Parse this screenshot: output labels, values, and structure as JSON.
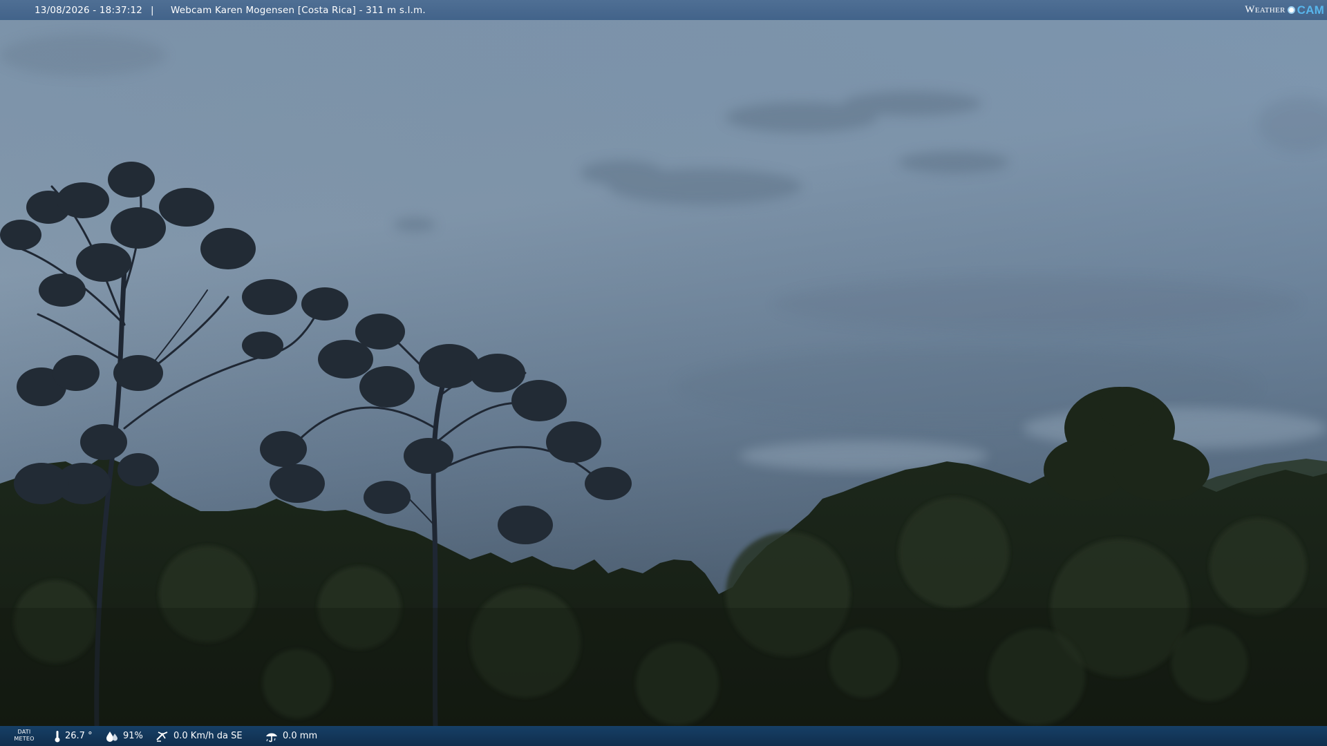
{
  "top_bar": {
    "timestamp": "13/08/2026 - 18:37:12",
    "separator": "|",
    "title": "Webcam Karen Mogensen [Costa Rica] - 311 m s.l.m.",
    "brand": {
      "word": "Weather",
      "mark": "CAM"
    }
  },
  "bottom_bar": {
    "label_line1": "DATI",
    "label_line2": "METEO",
    "metrics": [
      {
        "icon": "thermometer-icon",
        "value": "26.7 °"
      },
      {
        "icon": "humidity-drops-icon",
        "value": "91%"
      },
      {
        "icon": "wind-icon",
        "value": "0.0 Km/h da SE"
      },
      {
        "icon": "rain-icon",
        "value": "0.0 mm"
      }
    ]
  },
  "colors": {
    "top_bar": "#4a6a90",
    "bottom_bar": "#143a60",
    "brand_accent": "#58b6ec",
    "sky_top": "#9cb0c4",
    "sky_bottom": "#3d4d5e",
    "foliage": "#1b2418"
  }
}
